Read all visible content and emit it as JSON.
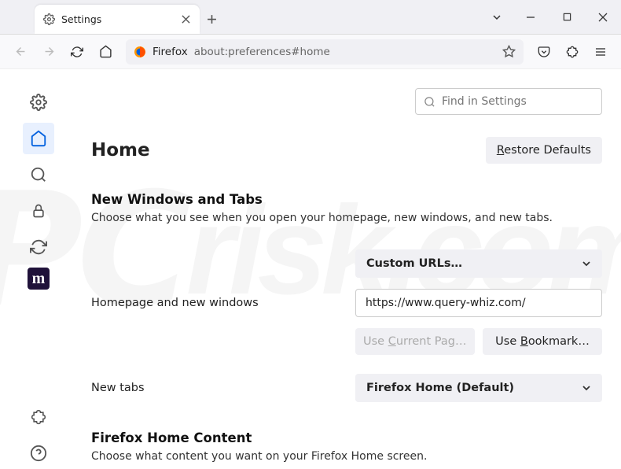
{
  "tab": {
    "title": "Settings"
  },
  "urlbar": {
    "prefix": "Firefox",
    "path": "about:preferences#home"
  },
  "search": {
    "placeholder": "Find in Settings"
  },
  "page": {
    "title": "Home",
    "restore": "estore Defaults",
    "restore_u": "R"
  },
  "section1": {
    "title": "New Windows and Tabs",
    "desc": "Choose what you see when you open your homepage, new windows, and new tabs."
  },
  "homepage": {
    "label": "Homepage and new windows",
    "select": "Custom URLs…",
    "url": "https://www.query-whiz.com/",
    "use_current_pre": "Use ",
    "use_current_u": "C",
    "use_current_post": "urrent Pages",
    "use_bookmark_pre": "Use ",
    "use_bookmark_u": "B",
    "use_bookmark_post": "ookmark…"
  },
  "newtabs": {
    "label": "New tabs",
    "select": "Firefox Home (Default)"
  },
  "section2": {
    "title": "Firefox Home Content",
    "desc": "Choose what content you want on your Firefox Home screen."
  }
}
